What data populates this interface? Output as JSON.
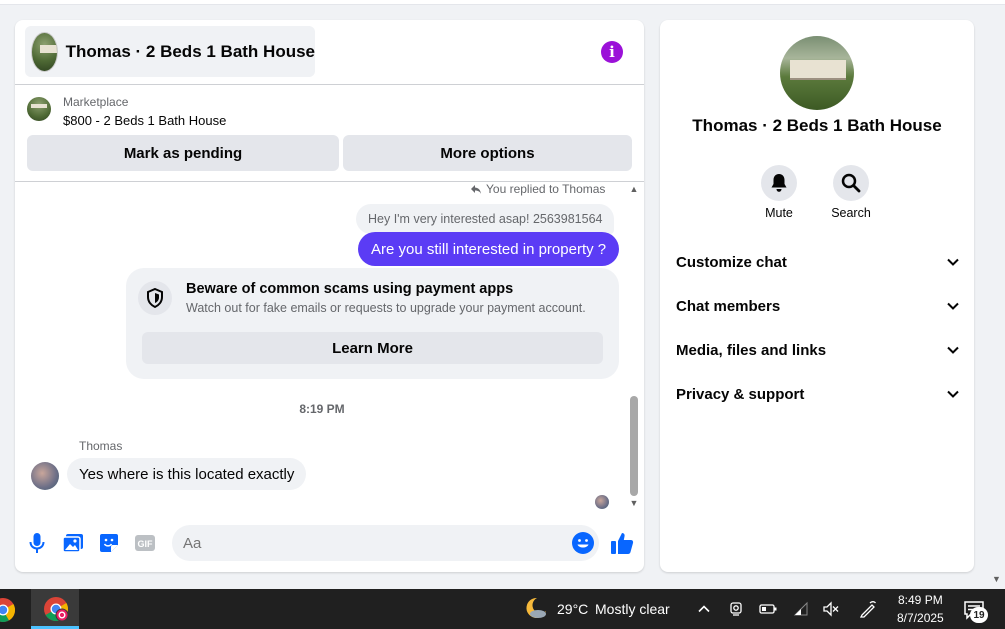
{
  "chat": {
    "title": "Thomas · 2 Beds 1 Bath House",
    "marketplace": {
      "label": "Marketplace",
      "item": "$800 - 2 Beds 1 Bath House"
    },
    "buttons": {
      "mark_pending": "Mark as pending",
      "more_options": "More options"
    },
    "reply_notice": "You replied to Thomas",
    "quoted_message": "Hey I'm very interested asap! 2563981564",
    "outgoing_message": "Are you still interested in property ?",
    "scam_warning": {
      "title": "Beware of common scams using payment apps",
      "description": "Watch out for fake emails or requests to upgrade your payment account.",
      "button": "Learn More"
    },
    "timestamp": "8:19 PM",
    "incoming": {
      "sender": "Thomas",
      "message": "Yes where is this located exactly"
    },
    "composer": {
      "placeholder": "Aa"
    },
    "accent_color": "#5b3cf5",
    "info_color": "#9b11d8"
  },
  "sidebar": {
    "title": "Thomas · 2 Beds 1 Bath House",
    "actions": [
      {
        "label": "Mute",
        "icon": "bell-icon"
      },
      {
        "label": "Search",
        "icon": "search-icon"
      }
    ],
    "sections": [
      {
        "label": "Customize chat"
      },
      {
        "label": "Chat members"
      },
      {
        "label": "Media, files and links"
      },
      {
        "label": "Privacy & support"
      }
    ]
  },
  "taskbar": {
    "weather_temp": "29°C",
    "weather_desc": "Mostly clear",
    "time": "8:49 PM",
    "date": "8/7/2025",
    "notification_count": "19"
  }
}
